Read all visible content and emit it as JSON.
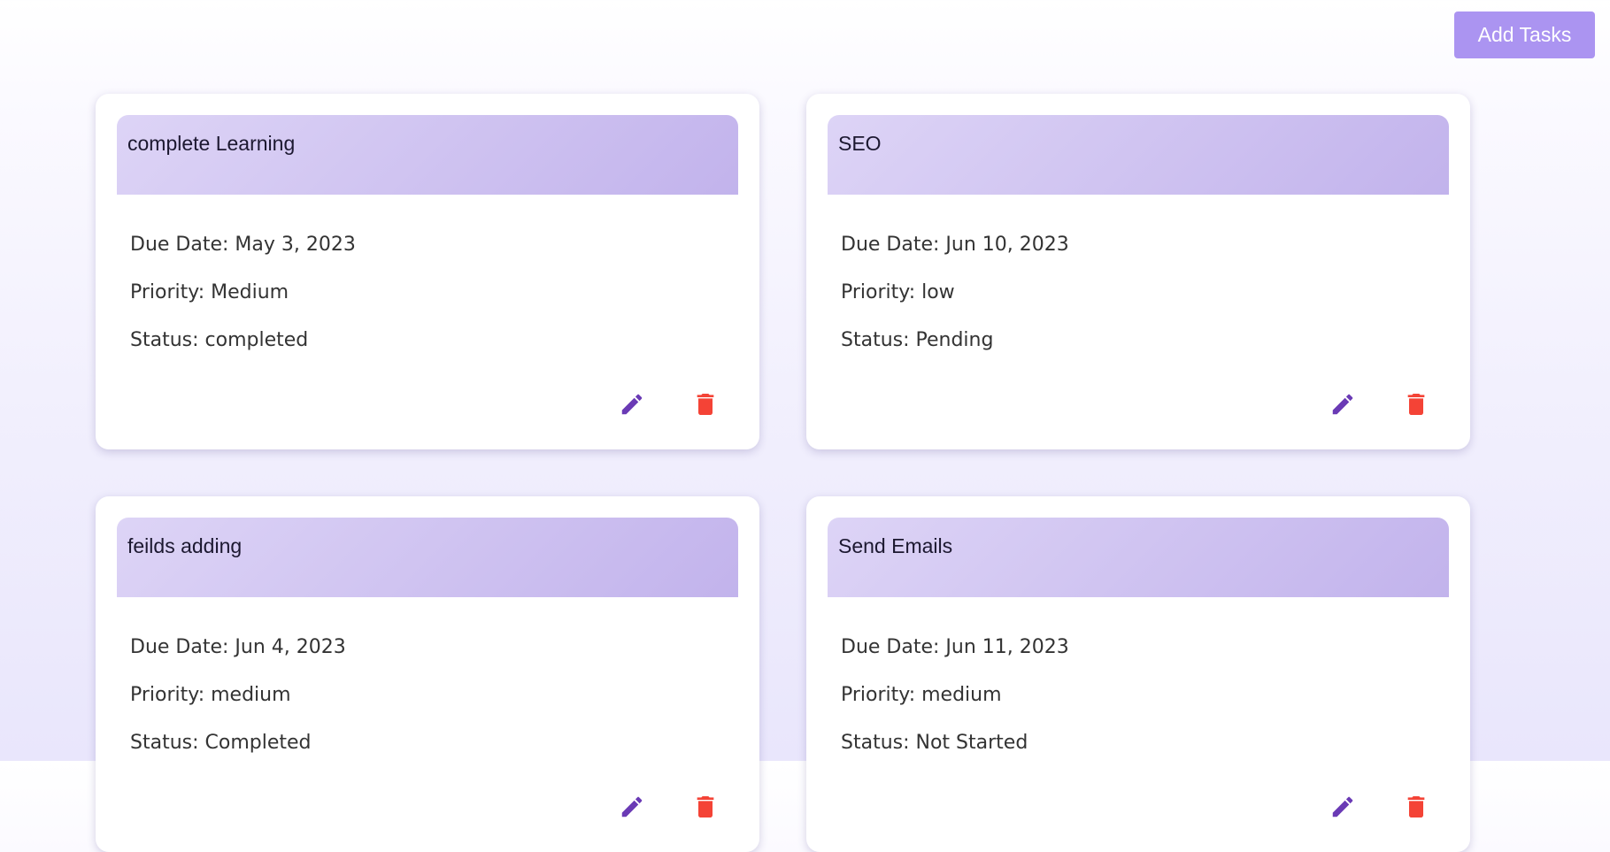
{
  "header": {
    "add_button_label": "Add Tasks"
  },
  "colors": {
    "accent": "#ab94f1",
    "edit_icon": "#6a3ab5",
    "delete_icon": "#f44336"
  },
  "labels": {
    "due_date": "Due Date:",
    "priority": "Priority:",
    "status": "Status:"
  },
  "tasks": [
    {
      "title": "complete Learning",
      "due_date": "Due Date: May 3, 2023",
      "priority": "Priority: Medium",
      "status": "Status: completed",
      "actions": [
        "edit-icon",
        "delete-icon"
      ]
    },
    {
      "title": "SEO",
      "due_date": "Due Date: Jun 10, 2023",
      "priority": "Priority: low",
      "status": "Status: Pending",
      "actions": [
        "edit-icon",
        "delete-icon"
      ]
    },
    {
      "title": "feilds adding",
      "due_date": "Due Date: Jun 4, 2023",
      "priority": "Priority: medium",
      "status": "Status: Completed",
      "actions": [
        "edit-icon",
        "delete-icon"
      ]
    },
    {
      "title": "Send Emails",
      "due_date": "Due Date: Jun 11, 2023",
      "priority": "Priority: medium",
      "status": "Status: Not Started",
      "actions": [
        "edit-icon",
        "delete-icon"
      ]
    }
  ]
}
